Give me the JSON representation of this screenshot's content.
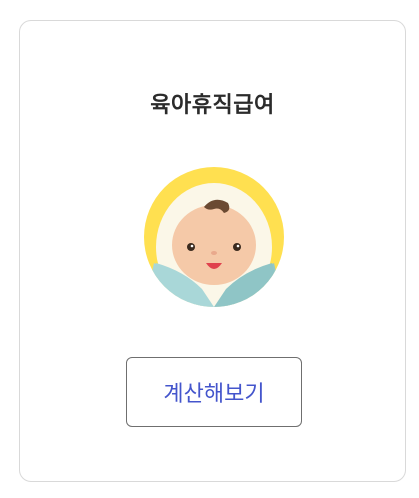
{
  "card": {
    "title": "육아휴직급여",
    "illustration": "baby-icon",
    "button_label": "계산해보기"
  },
  "colors": {
    "accent_text": "#4455cc",
    "halo_yellow": "#ffe050",
    "blanket_blue": "#a9d7d8"
  }
}
